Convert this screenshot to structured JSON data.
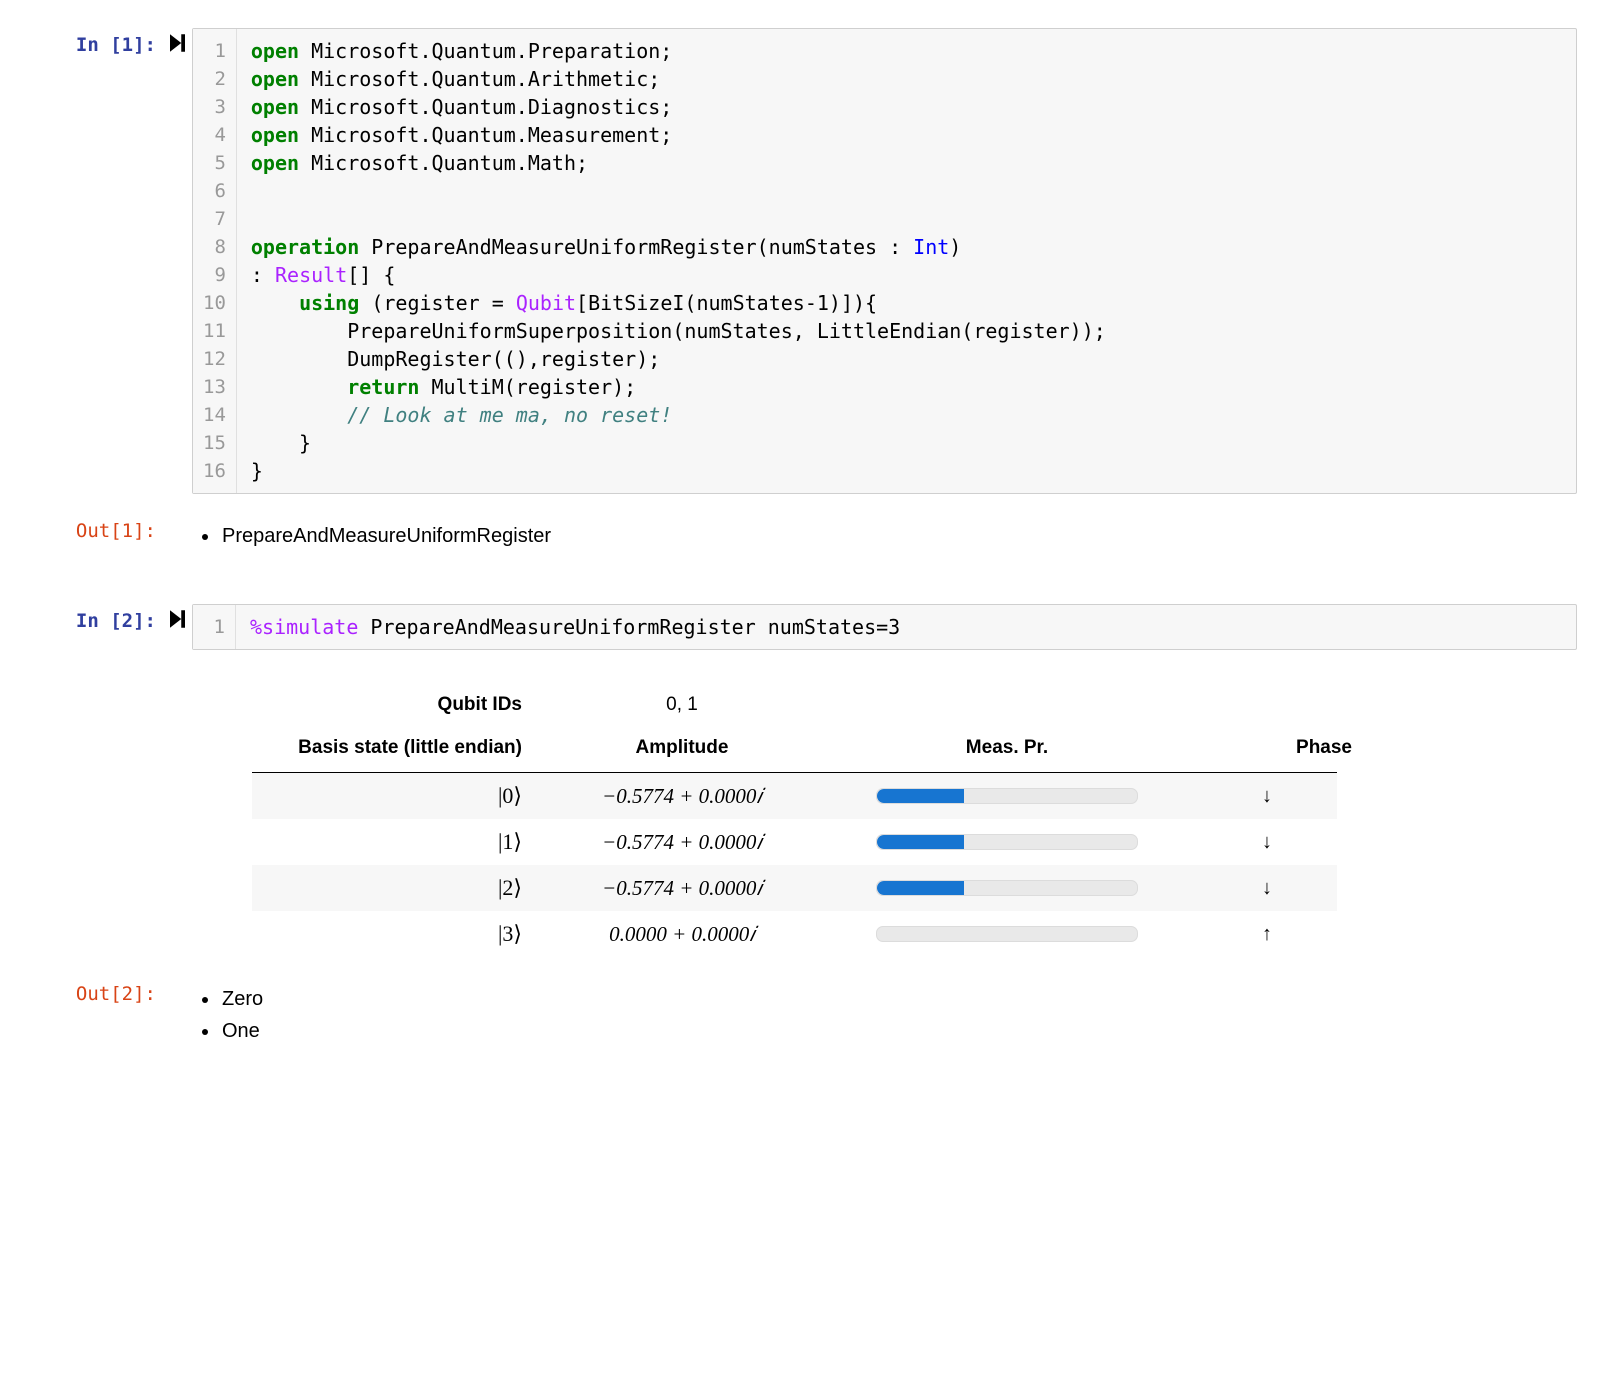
{
  "cells": {
    "c1": {
      "in_prompt": "In [1]:",
      "out_prompt": "Out[1]:",
      "code_lines": [
        [
          {
            "t": "open",
            "c": "kw"
          },
          {
            "t": " Microsoft.Quantum.Preparation;"
          }
        ],
        [
          {
            "t": "open",
            "c": "kw"
          },
          {
            "t": " Microsoft.Quantum.Arithmetic;"
          }
        ],
        [
          {
            "t": "open",
            "c": "kw"
          },
          {
            "t": " Microsoft.Quantum.Diagnostics;"
          }
        ],
        [
          {
            "t": "open",
            "c": "kw"
          },
          {
            "t": " Microsoft.Quantum.Measurement;"
          }
        ],
        [
          {
            "t": "open",
            "c": "kw"
          },
          {
            "t": " Microsoft.Quantum.Math;"
          }
        ],
        [],
        [],
        [
          {
            "t": "operation",
            "c": "kw"
          },
          {
            "t": " PrepareAndMeasureUniformRegister(numStates : "
          },
          {
            "t": "Int",
            "c": "ty"
          },
          {
            "t": ")"
          }
        ],
        [
          {
            "t": ": "
          },
          {
            "t": "Result",
            "c": "prg"
          },
          {
            "t": "[] {"
          }
        ],
        [
          {
            "t": "    "
          },
          {
            "t": "using",
            "c": "kw"
          },
          {
            "t": " (register = "
          },
          {
            "t": "Qubit",
            "c": "prg"
          },
          {
            "t": "[BitSizeI(numStates-1)]){"
          }
        ],
        [
          {
            "t": "        PrepareUniformSuperposition(numStates, LittleEndian(register));"
          }
        ],
        [
          {
            "t": "        DumpRegister((),register);"
          }
        ],
        [
          {
            "t": "        "
          },
          {
            "t": "return",
            "c": "kw"
          },
          {
            "t": " MultiM(register);"
          }
        ],
        [
          {
            "t": "        "
          },
          {
            "t": "// Look at me ma, no reset!",
            "c": "cm"
          }
        ],
        [
          {
            "t": "    }"
          }
        ],
        [
          {
            "t": "}"
          }
        ]
      ],
      "output_items": [
        "PrepareAndMeasureUniformRegister"
      ]
    },
    "c2": {
      "in_prompt": "In [2]:",
      "out_prompt": "Out[2]:",
      "code_lines": [
        [
          {
            "t": "%simulate",
            "c": "prg"
          },
          {
            "t": " PrepareAndMeasureUniformRegister numStates=3"
          }
        ]
      ],
      "qubit_ids_label": "Qubit IDs",
      "qubit_ids": "0, 1",
      "headers": {
        "basis": "Basis state (little endian)",
        "amp": "Amplitude",
        "meas": "Meas. Pr.",
        "phase": "Phase"
      },
      "rows": [
        {
          "basis": "|0⟩",
          "amp": "−0.5774 + 0.0000𝑖",
          "prob": 0.3333,
          "phase": "↓"
        },
        {
          "basis": "|1⟩",
          "amp": "−0.5774 + 0.0000𝑖",
          "prob": 0.3333,
          "phase": "↓"
        },
        {
          "basis": "|2⟩",
          "amp": "−0.5774 + 0.0000𝑖",
          "prob": 0.3333,
          "phase": "↓"
        },
        {
          "basis": "|3⟩",
          "amp": "0.0000 + 0.0000𝑖",
          "prob": 0.0,
          "phase": "↑"
        }
      ],
      "output_items": [
        "Zero",
        "One"
      ]
    }
  },
  "chart_data": {
    "type": "table",
    "title": "Quantum state dump (DumpRegister)",
    "qubit_ids": [
      0,
      1
    ],
    "basis_endianness": "little",
    "columns": [
      "Basis state (little endian)",
      "Amplitude",
      "Meas. Pr.",
      "Phase"
    ],
    "states": [
      {
        "basis": 0,
        "re": -0.5774,
        "im": 0.0,
        "probability": 0.3333,
        "phase_arrow": "down"
      },
      {
        "basis": 1,
        "re": -0.5774,
        "im": 0.0,
        "probability": 0.3333,
        "phase_arrow": "down"
      },
      {
        "basis": 2,
        "re": -0.5774,
        "im": 0.0,
        "probability": 0.3333,
        "phase_arrow": "down"
      },
      {
        "basis": 3,
        "re": 0.0,
        "im": 0.0,
        "probability": 0.0,
        "phase_arrow": "up"
      }
    ]
  }
}
